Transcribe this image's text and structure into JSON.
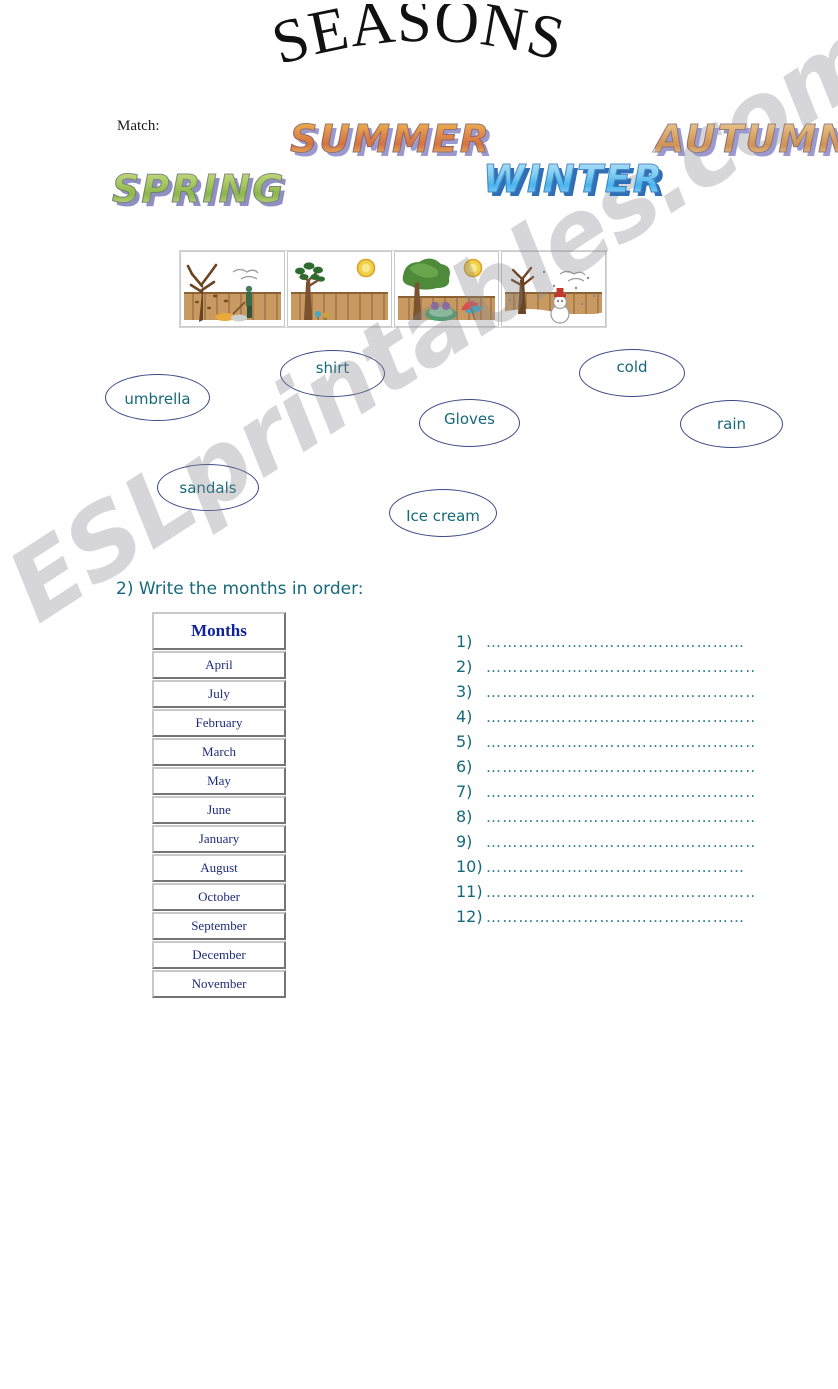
{
  "page": {
    "title": "SEASONS",
    "watermark": "ESLprintables.com"
  },
  "exercise1": {
    "instruction": "Match:",
    "seasons": [
      {
        "label": "SPRING",
        "face_color": "#a7c760",
        "shadow_color": "#8f8fc4"
      },
      {
        "label": "SUMMER",
        "face_color": "#e08a4a",
        "shadow_color": "#9a9ad0"
      },
      {
        "label": "WINTER",
        "face_color": "#49b4ec",
        "shadow_color": "#2f6fb5"
      },
      {
        "label": "AUTUMN",
        "face_color": "#cf9255",
        "shadow_color": "#9a9ad0"
      }
    ],
    "pictures": [
      {
        "name": "autumn-scene",
        "alt": "Bare tree with falling leaves, clouds, person raking by a wooden fence"
      },
      {
        "name": "spring-scene",
        "alt": "Tree with new leaves, sun and small flowers by a wooden fence"
      },
      {
        "name": "summer-scene",
        "alt": "Full green tree, bright sun, children in a paddling pool and a beach umbrella"
      },
      {
        "name": "winter-scene",
        "alt": "Bare tree, falling snow and a snowman with a red hat by a wooden fence"
      }
    ],
    "word_bubbles": [
      {
        "id": "umbrella",
        "label": "umbrella"
      },
      {
        "id": "shirt",
        "label": "shirt"
      },
      {
        "id": "sandals",
        "label": "sandals"
      },
      {
        "id": "gloves",
        "label": "Gloves"
      },
      {
        "id": "icecream",
        "label": "Ice cream"
      },
      {
        "id": "cold",
        "label": "cold"
      },
      {
        "id": "rain",
        "label": "rain"
      }
    ],
    "bubble_text_color": "#16697a",
    "bubble_border_color": "#3b4a86"
  },
  "exercise2": {
    "instruction": "2) Write the months in order:",
    "instruction_color": "#17697c",
    "table": {
      "header": "Months",
      "header_color": "#11239b",
      "months": [
        "April",
        "July",
        "February",
        "March",
        "May",
        "June",
        "January",
        "August",
        "October",
        "September",
        "December",
        "November"
      ]
    },
    "answer_lines": [
      {
        "number": "1)",
        "dots": "…………………………………………"
      },
      {
        "number": "2)",
        "dots": "……………………………………………"
      },
      {
        "number": "3)",
        "dots": "………………………………………………"
      },
      {
        "number": "4)",
        "dots": "……………………………………………"
      },
      {
        "number": "5)",
        "dots": "………………………………………………"
      },
      {
        "number": "6)",
        "dots": "……………………………………………"
      },
      {
        "number": "7)",
        "dots": "……………………………………………"
      },
      {
        "number": "8)",
        "dots": "……………………………………………"
      },
      {
        "number": "9)",
        "dots": "……………………………………………"
      },
      {
        "number": "10)",
        "dots": "…………………………………………"
      },
      {
        "number": "11)",
        "dots": "……………………………………………"
      },
      {
        "number": "12)",
        "dots": "…………………………………………"
      }
    ]
  }
}
